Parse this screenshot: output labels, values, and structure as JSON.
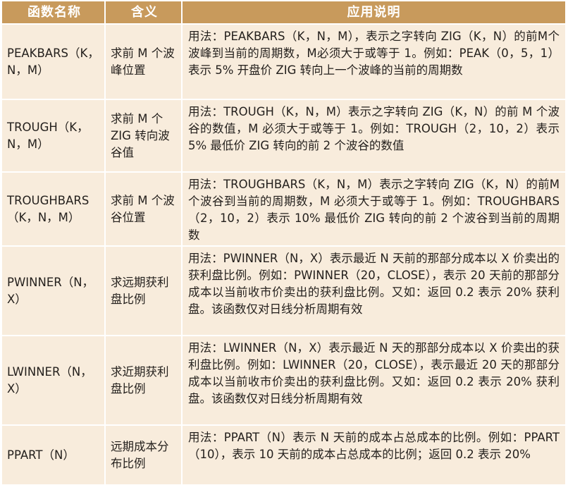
{
  "headers": {
    "name": "函数名称",
    "meaning": "含义",
    "usage": "应用说明"
  },
  "rows": [
    {
      "name": "PEAKBARS（K，N，M）",
      "meaning": "求前 M 个波峰位置",
      "usage": "用法：PEAKBARS（K，N，M），表示之字转向 ZIG（K，N）的前M个波峰到当前的周期数，M必须大于或等于 1。例如：PEAK（0，5，1）表示 5% 开盘价 ZIG 转向上一个波峰的当前的周期数"
    },
    {
      "name": "TROUGH（K，N，M）",
      "meaning": "求前 M 个 ZIG 转向波谷值",
      "usage": "用法：TROUGH（K，N，M）表示之字转向 ZIG（K，N）的前 M 个波谷的数值，M 必须大于或等于 1。例如：TROUGH（2，10，2）表示 5% 最低价 ZIG 转向的前 2 个波谷的数值"
    },
    {
      "name": "TROUGHBARS（K，N，M）",
      "meaning": "求前 M 个波谷位置",
      "usage": "用法：TROUGHBARS（K，N，M）表示之字转向 ZIG（K，N）的前M个波谷到当前的周期数，M 必须大于或等于 1。例如：TROUGHBARS（2，10，2）表示 10% 最低价 ZIG 转向的前 2 个波谷到当前的周期数"
    },
    {
      "name": "PWINNER（N，X）",
      "meaning": "求远期获利盘比例",
      "usage": "用法：PWINNER（N，X）表示最近 N 天前的那部分成本以 X 价卖出的获利盘比例。例如：PWINNER（20，CLOSE），表示 20 天前的那部分成本以当前收市价卖出的获利盘比例。又如：返回 0.2 表示 20% 获利盘。该函数仅对日线分析周期有效"
    },
    {
      "name": "LWINNER（N，X）",
      "meaning": "求近期获利盘比例",
      "usage": "用法：LWINNER（N，X）表示最近 N 天的那部分成本以 X 价卖出的获利盘比例。例如：LWINNER（20，CLOSE），表示最近 20 天的那部分成本以当前收市价卖出的获利盘比例。又如：返回 0.2 表示 20% 获利盘。该函数仅对日线分析周期有效"
    },
    {
      "name": "PPART（N）",
      "meaning": "远期成本分布比例",
      "usage": "用法：PPART（N）表示 N 天前的成本占总成本的比例。例如：PPART（10），表示 10 天前的成本占总成本的比例；返回 0.2 表示 20%"
    }
  ],
  "colors": {
    "header_bg": "#c89a5c",
    "stripe_bg": "#f8ecdc",
    "text": "#231f1c"
  }
}
